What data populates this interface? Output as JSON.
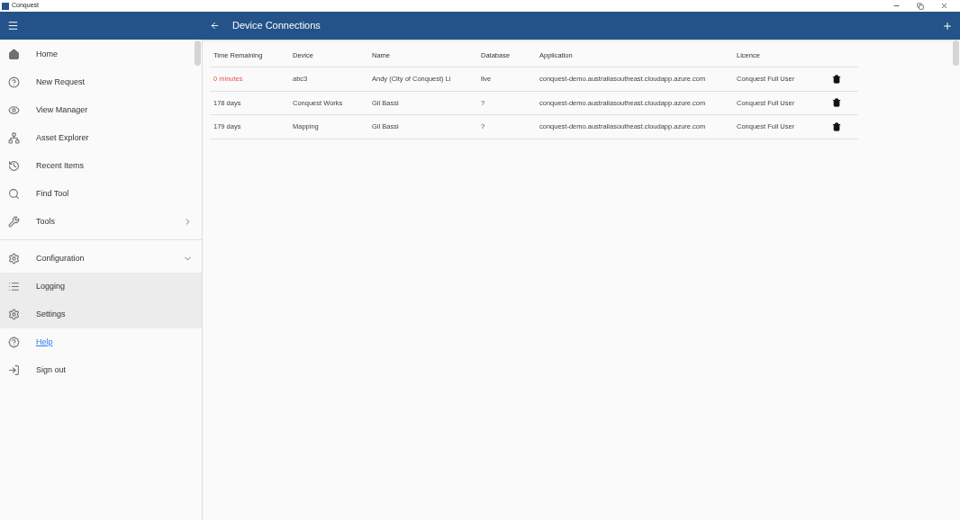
{
  "window": {
    "title": "Conquest"
  },
  "app_bar": {
    "title": "Device Connections"
  },
  "sidebar": {
    "items": [
      {
        "label": "Home",
        "kind": "item"
      },
      {
        "label": "New Request",
        "kind": "item"
      },
      {
        "label": "View Manager",
        "kind": "item"
      },
      {
        "label": "Asset Explorer",
        "kind": "item"
      },
      {
        "label": "Recent Items",
        "kind": "item"
      },
      {
        "label": "Find Tool",
        "kind": "item"
      },
      {
        "label": "Tools",
        "kind": "submenu",
        "expanded": false
      },
      {
        "label": "Configuration",
        "kind": "submenu",
        "expanded": true,
        "children": [
          {
            "label": "Logging"
          },
          {
            "label": "Settings"
          }
        ]
      },
      {
        "label": "Help",
        "kind": "link"
      },
      {
        "label": "Sign out",
        "kind": "item"
      }
    ]
  },
  "table": {
    "columns": [
      "Time Remaining",
      "Device",
      "Name",
      "Database",
      "Application",
      "Licence"
    ],
    "rows": [
      {
        "time_remaining": "0 minutes",
        "expired": true,
        "device": "abc3",
        "name": "Andy (City of Conquest) Li",
        "database": "live",
        "application": "conquest-demo.australiasoutheast.cloudapp.azure.com",
        "licence": "Conquest Full User"
      },
      {
        "time_remaining": "178 days",
        "expired": false,
        "device": "Conquest Works",
        "name": "Gil Bassi",
        "database": "?",
        "application": "conquest-demo.australiasoutheast.cloudapp.azure.com",
        "licence": "Conquest Full User"
      },
      {
        "time_remaining": "179 days",
        "expired": false,
        "device": "Mapping",
        "name": "Gil Bassi",
        "database": "?",
        "application": "conquest-demo.australiasoutheast.cloudapp.azure.com",
        "licence": "Conquest Full User"
      }
    ]
  }
}
